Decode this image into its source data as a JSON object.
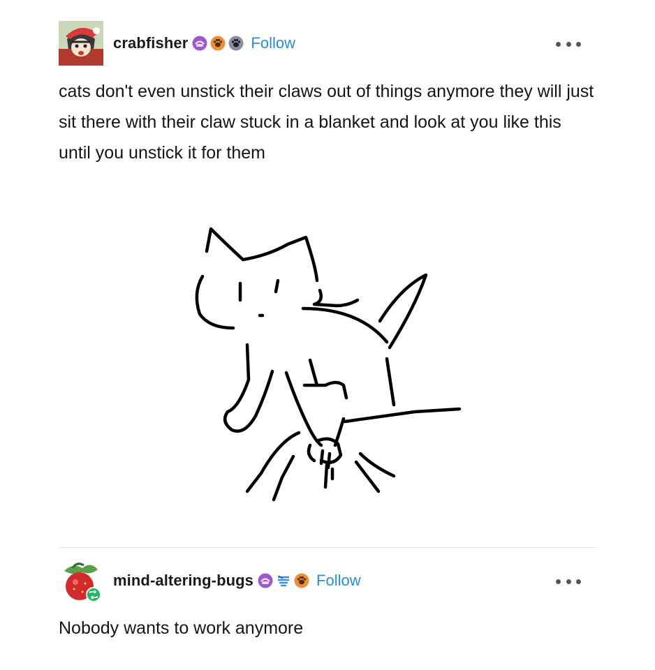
{
  "posts": [
    {
      "username": "crabfisher",
      "follow_label": "Follow",
      "badges": [
        "purple-pride-badge-icon",
        "orange-paw-badge-icon",
        "grey-paw-badge-icon"
      ],
      "body": "cats don't even unstick their claws out of things anymore they will just sit there with their claw stuck in a blanket and look at you like this until you unstick it for them",
      "has_image": true
    },
    {
      "username": "mind-altering-bugs",
      "follow_label": "Follow",
      "badges": [
        "purple-pride-badge-icon",
        "blue-bug-badge-icon",
        "orange-paw-badge-icon"
      ],
      "reblog_indicator": "green-reblog-icon",
      "body": "Nobody wants to work anymore"
    }
  ],
  "colors": {
    "follow": "#2a8cd4",
    "text": "#141414",
    "divider": "#e2e2e2",
    "reblog_badge": "#28b463"
  }
}
